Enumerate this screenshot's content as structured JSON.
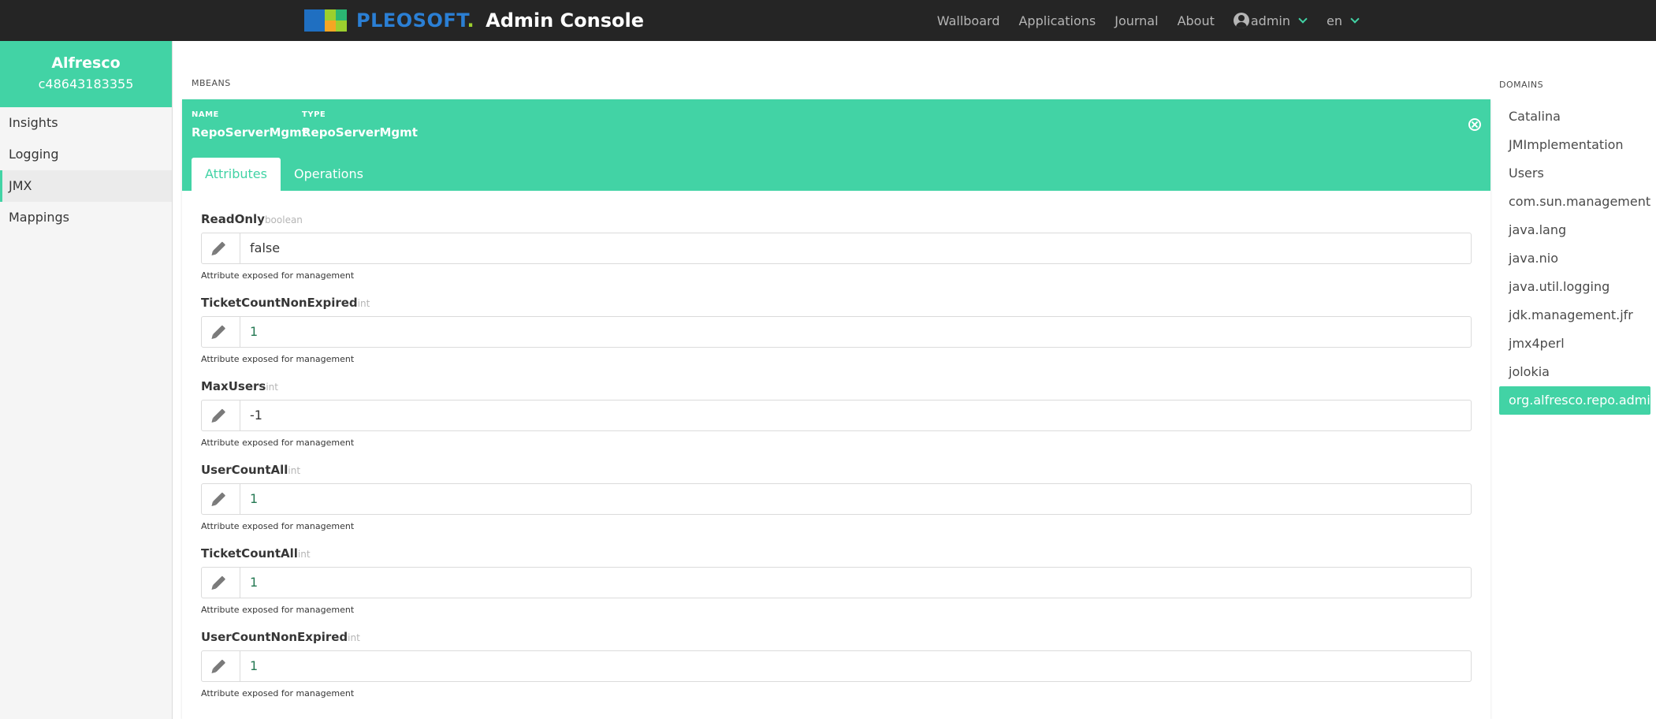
{
  "brand": {
    "logo_word": "PLEOSOFT",
    "logo_dot": ".",
    "title": "Admin Console",
    "logo_colors": [
      "#1f6fc1",
      "#9ccf2e",
      "#f5a623",
      "#2bb673"
    ]
  },
  "nav": {
    "links": [
      "Wallboard",
      "Applications",
      "Journal",
      "About"
    ],
    "user": "admin",
    "language": "en"
  },
  "sidebar": {
    "instance_name": "Alfresco",
    "instance_id": "c48643183355",
    "items": [
      {
        "label": "Insights"
      },
      {
        "label": "Logging"
      },
      {
        "label": "JMX"
      },
      {
        "label": "Mappings"
      }
    ],
    "active": "JMX"
  },
  "main": {
    "section_label": "MBEANS",
    "mbean": {
      "name_key": "NAME",
      "name_value": "RepoServerMgmt",
      "type_key": "TYPE",
      "type_value": "RepoServerMgmt"
    },
    "tabs": [
      {
        "label": "Attributes"
      },
      {
        "label": "Operations"
      }
    ],
    "active_tab": "Attributes",
    "attributes": [
      {
        "name": "ReadOnly",
        "type": "boolean",
        "value": "false",
        "description": "Attribute exposed for management"
      },
      {
        "name": "TicketCountNonExpired",
        "type": "int",
        "value": "1",
        "description": "Attribute exposed for management"
      },
      {
        "name": "MaxUsers",
        "type": "int",
        "value": "-1",
        "description": "Attribute exposed for management"
      },
      {
        "name": "UserCountAll",
        "type": "int",
        "value": "1",
        "description": "Attribute exposed for management"
      },
      {
        "name": "TicketCountAll",
        "type": "int",
        "value": "1",
        "description": "Attribute exposed for management"
      },
      {
        "name": "UserCountNonExpired",
        "type": "int",
        "value": "1",
        "description": "Attribute exposed for management"
      }
    ]
  },
  "domains": {
    "label": "DOMAINS",
    "items": [
      {
        "label": "Catalina"
      },
      {
        "label": "JMImplementation"
      },
      {
        "label": "Users"
      },
      {
        "label": "com.sun.management"
      },
      {
        "label": "java.lang"
      },
      {
        "label": "java.nio"
      },
      {
        "label": "java.util.logging"
      },
      {
        "label": "jdk.management.jfr"
      },
      {
        "label": "jmx4perl"
      },
      {
        "label": "jolokia"
      },
      {
        "label": "org.alfresco.repo.admin"
      }
    ],
    "active": "org.alfresco.repo.admin"
  },
  "colors": {
    "accent": "#42d3a5",
    "navbar": "#252525",
    "number_value": "#257953"
  }
}
